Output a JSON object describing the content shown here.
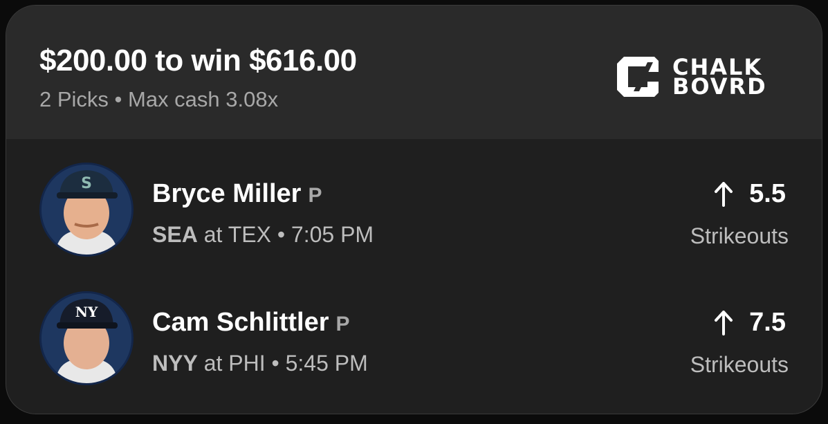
{
  "header": {
    "wager_title": "$200.00 to win $616.00",
    "wager_sub": "2 Picks • Max cash 3.08x",
    "logo": {
      "icon": "chalkboard-logo-icon",
      "line1": "CHALK",
      "line2": "BOVRD"
    }
  },
  "picks": [
    {
      "player": "Bryce Miller",
      "position": "P",
      "team": "SEA",
      "matchup": " at TEX • 7:05 PM",
      "direction": "up-arrow-icon",
      "line": "5.5",
      "stat": "Strikeouts",
      "cap_logo": "S"
    },
    {
      "player": "Cam Schlittler",
      "position": "P",
      "team": "NYY",
      "matchup": " at PHI • 5:45 PM",
      "direction": "up-arrow-icon",
      "line": "7.5",
      "stat": "Strikeouts",
      "cap_logo": "NY"
    }
  ],
  "colors": {
    "background": "#0b0b0b",
    "card": "#1f1f1f",
    "header": "#2a2a2a",
    "avatar_bg": "#1e3760"
  }
}
